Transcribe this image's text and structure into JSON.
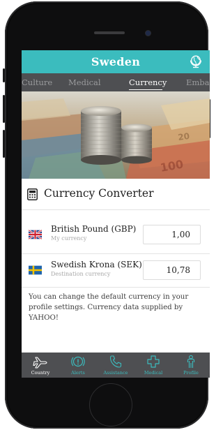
{
  "app": {
    "title": "Sweden"
  },
  "tabs": [
    {
      "label": "Culture"
    },
    {
      "label": "Medical"
    },
    {
      "label": "Currency",
      "active": true
    },
    {
      "label": "Embas"
    }
  ],
  "converter": {
    "title": "Currency Converter",
    "rows": [
      {
        "name": "British Pound (GBP)",
        "sub": "My currency",
        "value": "1,00",
        "flag": "uk-flag-icon"
      },
      {
        "name": "Swedish Krona (SEK)",
        "sub": "Destination currency",
        "value": "10,78",
        "flag": "sweden-flag-icon"
      }
    ],
    "info": "You can change the default currency in your profile settings. Currency data supplied by YAHOO!"
  },
  "bottom_nav": [
    {
      "label": "Country",
      "icon": "plane-icon",
      "active": true
    },
    {
      "label": "Alerts",
      "icon": "alert-icon"
    },
    {
      "label": "Assistance",
      "icon": "phone-icon"
    },
    {
      "label": "Medical",
      "icon": "medical-cross-icon"
    },
    {
      "label": "Profile",
      "icon": "profile-icon"
    }
  ],
  "colors": {
    "accent": "#3bbcbe",
    "bar": "#4e4f52",
    "text": "#1e1e1e",
    "muted": "#a9a9a9"
  }
}
